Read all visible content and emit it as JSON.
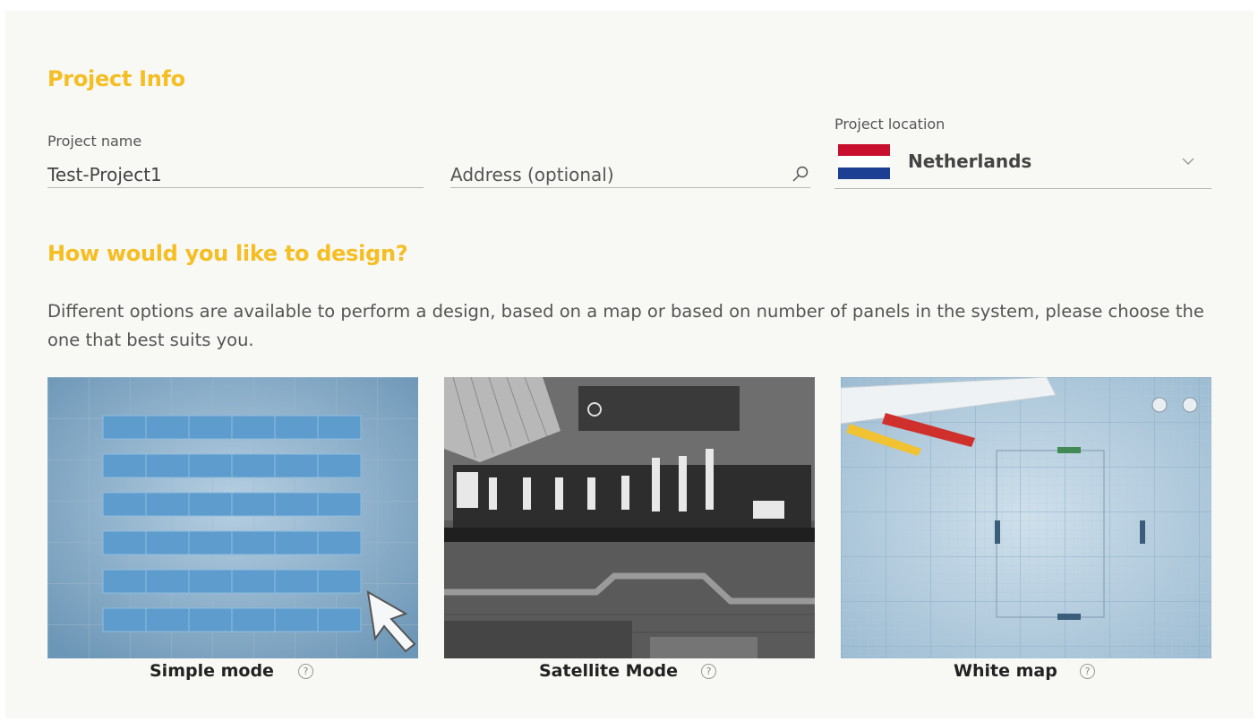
{
  "project_info": {
    "heading": "Project Info",
    "name_label": "Project name",
    "name_value": "Test-Project1",
    "address_placeholder": "Address (optional)",
    "location_label": "Project location",
    "country": "Netherlands",
    "flag_colors": [
      "#c8102e",
      "#ffffff",
      "#1c3f94"
    ]
  },
  "design": {
    "heading": "How would you like to design?",
    "description": "Different options are available to perform a design, based on a map or based on number of panels in the system, please choose the one that best suits you.",
    "options": [
      {
        "label": "Simple mode",
        "help": "?"
      },
      {
        "label": "Satellite Mode",
        "help": "?"
      },
      {
        "label": "White map",
        "help": "?"
      }
    ]
  },
  "colors": {
    "accent": "#f5be22"
  }
}
